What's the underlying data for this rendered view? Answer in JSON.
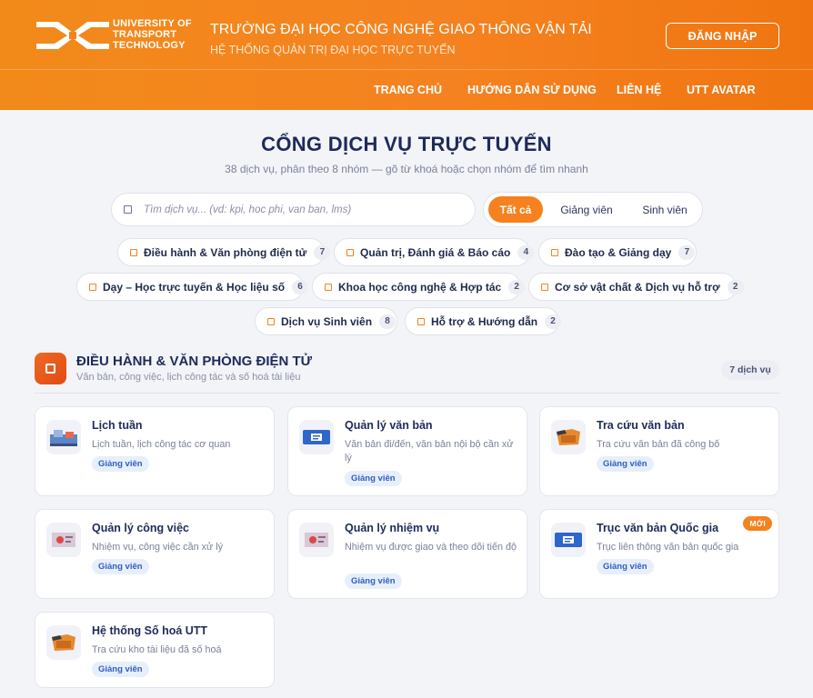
{
  "header": {
    "brand_lines": [
      "UNIVERSITY OF",
      "TRANSPORT",
      "TECHNOLOGY"
    ],
    "university_name": "TRƯỜNG ĐẠI HỌC CÔNG NGHỆ GIAO THÔNG VẬN TẢI",
    "system_name": "HỆ THỐNG QUẢN TRỊ ĐẠI HỌC TRỰC TUYẾN",
    "login_label": "ĐĂNG NHẬP",
    "nav": [
      "TRANG CHỦ",
      "HƯỚNG DẪN SỬ DỤNG",
      "LIÊN HỆ",
      "UTT AVATAR"
    ]
  },
  "main": {
    "title": "CỔNG DỊCH VỤ TRỰC TUYẾN",
    "subtitle": "38 dịch vụ, phân theo 8 nhóm — gõ từ khoá hoặc chọn nhóm để tìm nhanh",
    "search_placeholder": "Tìm dịch vụ... (vd: kpi, hoc phi, van ban, lms)",
    "audience_filters": [
      "Tất cả",
      "Giảng viên",
      "Sinh viên"
    ],
    "active_filter": "Tất cả",
    "categories": [
      {
        "label": "Điều hành & Văn phòng điện tử",
        "count": "7"
      },
      {
        "label": "Quản trị, Đánh giá & Báo cáo",
        "count": "4"
      },
      {
        "label": "Đào tạo & Giảng dạy",
        "count": "7"
      },
      {
        "label": "Dạy – Học trực tuyến & Học liệu số",
        "count": "6"
      },
      {
        "label": "Khoa học công nghệ & Hợp tác",
        "count": "2"
      },
      {
        "label": "Cơ sở vật chất & Dịch vụ hỗ trợ",
        "count": "2"
      },
      {
        "label": "Dịch vụ Sinh viên",
        "count": "8"
      },
      {
        "label": "Hỗ trợ & Hướng dẫn",
        "count": "2"
      }
    ]
  },
  "section": {
    "title": "ĐIỀU HÀNH & VĂN PHÒNG ĐIỆN TỬ",
    "subtitle": "Văn bản, công việc, lịch công tác và số hoá tài liệu",
    "count_label": "7 dịch vụ",
    "cards": [
      {
        "title": "Lịch tuần",
        "desc": "Lịch tuần, lịch công tác cơ quan",
        "tag": "Giảng viên",
        "icon": "calendar-icon"
      },
      {
        "title": "Quản lý văn bản",
        "desc": "Văn bản đi/đến, văn bản nội bộ cần xử lý",
        "tag": "Giảng viên",
        "icon": "document-icon"
      },
      {
        "title": "Tra cứu văn bản",
        "desc": "Tra cứu văn bản đã công bố",
        "tag": "Giảng viên",
        "icon": "folder-icon"
      },
      {
        "title": "Quản lý công việc",
        "desc": "Nhiệm vụ, công việc cần xử lý",
        "tag": "Giảng viên",
        "icon": "task-icon"
      },
      {
        "title": "Quản lý nhiệm vụ",
        "desc": "Nhiệm vụ được giao và theo dõi tiến độ",
        "tag": "Giảng viên",
        "icon": "task-icon"
      },
      {
        "title": "Trục văn bản Quốc gia",
        "desc": "Trục liên thông văn bản quốc gia",
        "tag": "Giảng viên",
        "icon": "document-icon",
        "badge": "MỚI"
      },
      {
        "title": "Hệ thống Số hoá UTT",
        "desc": "Tra cứu kho tài liệu đã số hoá",
        "tag": "Giảng viên",
        "icon": "folder-icon"
      }
    ]
  },
  "colors": {
    "accent": "#f5811f",
    "heading": "#1d2b5a",
    "tag_bg": "#e7effd",
    "tag_text": "#2f5fbf"
  }
}
